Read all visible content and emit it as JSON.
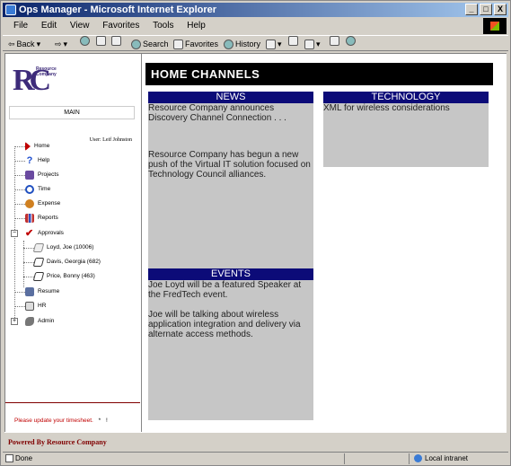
{
  "window": {
    "title": "Ops Manager - Microsoft Internet Explorer",
    "btn_min": "_",
    "btn_max": "□",
    "btn_close": "X"
  },
  "menu": [
    "File",
    "Edit",
    "View",
    "Favorites",
    "Tools",
    "Help"
  ],
  "toolbar": {
    "back": "Back",
    "search": "Search",
    "favorites": "Favorites",
    "history": "History"
  },
  "sidebar": {
    "logo_letters": "RC",
    "logo_text": "Resource Company",
    "main_label": "MAIN",
    "user_line": "User: Leif Johnston",
    "items": [
      {
        "label": "Home",
        "icon": "home-icon",
        "color": "#c00000"
      },
      {
        "label": "Help",
        "icon": "help-icon",
        "color": "#1f4fd0"
      },
      {
        "label": "Projects",
        "icon": "projects-icon",
        "color": "#6a4aa0"
      },
      {
        "label": "Time",
        "icon": "clock-icon",
        "color": "#2050c0"
      },
      {
        "label": "Expense",
        "icon": "coins-icon",
        "color": "#d08020"
      },
      {
        "label": "Reports",
        "icon": "chart-icon",
        "color": "#c03030"
      },
      {
        "label": "Approvals",
        "icon": "checkmark-icon",
        "color": "#c00000"
      },
      {
        "label": "Loyd, Joe (10006)",
        "icon": "approval-doc-icon",
        "color": "#888888"
      },
      {
        "label": "Davis, Georgia (682)",
        "icon": "approval-doc-icon",
        "color": "#333333"
      },
      {
        "label": "Price, Bonny (463)",
        "icon": "approval-doc-icon",
        "color": "#333333"
      },
      {
        "label": "Resume",
        "icon": "resume-icon",
        "color": "#5a6fa0"
      },
      {
        "label": "HR",
        "icon": "hr-icon",
        "color": "#555555"
      },
      {
        "label": "Admin",
        "icon": "wrench-icon",
        "color": "#777777"
      }
    ],
    "update_msg": "Please update your timesheet.",
    "update_star": "*",
    "update_mark": "!"
  },
  "content": {
    "header": "HOME CHANNELS",
    "news": {
      "title": "NEWS",
      "items": [
        "Resource Company announces Discovery Channel Connection . . .",
        "Resource Company has begun a new push of the Virtual IT solution focused on Technology Council alliances."
      ]
    },
    "technology": {
      "title": "TECHNOLOGY",
      "items": [
        "XML for wireless considerations"
      ]
    },
    "events": {
      "title": "EVENTS",
      "items": [
        "Joe Loyd will be a featured Speaker at the FredTech event.",
        "Joe will be talking about wireless application integration and delivery via alternate access methods."
      ]
    }
  },
  "footer": {
    "powered": "Powered By Resource Company"
  },
  "status": {
    "text": "Done",
    "zone": "Local intranet"
  }
}
